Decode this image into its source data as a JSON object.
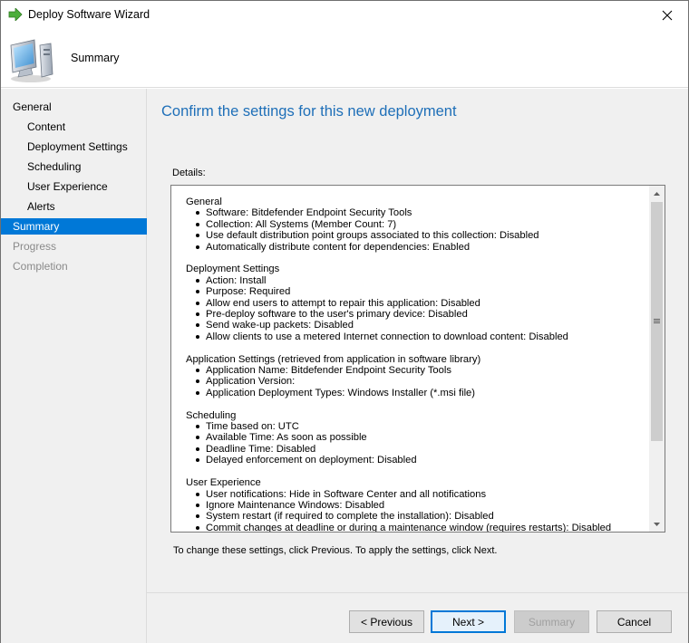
{
  "window": {
    "title": "Deploy Software Wizard",
    "step_title": "Summary",
    "accent_color": "#0078d7",
    "heading_color": "#1e6fb8"
  },
  "nav": {
    "items": [
      {
        "label": "General",
        "level": 1,
        "state": "normal"
      },
      {
        "label": "Content",
        "level": 2,
        "state": "normal"
      },
      {
        "label": "Deployment Settings",
        "level": 2,
        "state": "normal"
      },
      {
        "label": "Scheduling",
        "level": 2,
        "state": "normal"
      },
      {
        "label": "User Experience",
        "level": 2,
        "state": "normal"
      },
      {
        "label": "Alerts",
        "level": 2,
        "state": "normal"
      },
      {
        "label": "Summary",
        "level": 1,
        "state": "active"
      },
      {
        "label": "Progress",
        "level": 1,
        "state": "disabled"
      },
      {
        "label": "Completion",
        "level": 1,
        "state": "disabled"
      }
    ]
  },
  "main": {
    "heading": "Confirm the settings for this new deployment",
    "details_label": "Details:",
    "footer_note": "To change these settings, click Previous. To apply the settings, click Next.",
    "details": [
      {
        "title": "General",
        "items": [
          "Software: Bitdefender Endpoint Security Tools",
          "Collection: All Systems (Member Count: 7)",
          "Use default distribution point groups associated to this collection: Disabled",
          "Automatically distribute content for dependencies: Enabled"
        ]
      },
      {
        "title": "Deployment Settings",
        "items": [
          "Action: Install",
          "Purpose: Required",
          "Allow end users to attempt to repair this application: Disabled",
          "Pre-deploy software to the user's primary device: Disabled",
          "Send wake-up packets: Disabled",
          "Allow clients to use a metered Internet connection to download content: Disabled"
        ]
      },
      {
        "title": "Application Settings (retrieved from application in software library)",
        "items": [
          "Application Name: Bitdefender Endpoint Security Tools",
          "Application Version:",
          "Application Deployment Types: Windows Installer (*.msi file)"
        ]
      },
      {
        "title": "Scheduling",
        "items": [
          "Time based on: UTC",
          "Available Time: As soon as possible",
          "Deadline Time: Disabled",
          "Delayed enforcement on deployment: Disabled"
        ]
      },
      {
        "title": "User Experience",
        "items": [
          "User notifications: Hide in Software Center and all notifications",
          "Ignore Maintenance Windows: Disabled",
          "System restart  (if required to complete the installation): Disabled",
          "Commit changes at deadline or during a maintenance window (requires restarts): Disabled"
        ]
      }
    ]
  },
  "buttons": {
    "previous": "< Previous",
    "next": "Next >",
    "summary": "Summary",
    "cancel": "Cancel"
  },
  "icons": {
    "title": "green-arrow-icon",
    "header": "computer-icon",
    "close": "close-icon"
  }
}
